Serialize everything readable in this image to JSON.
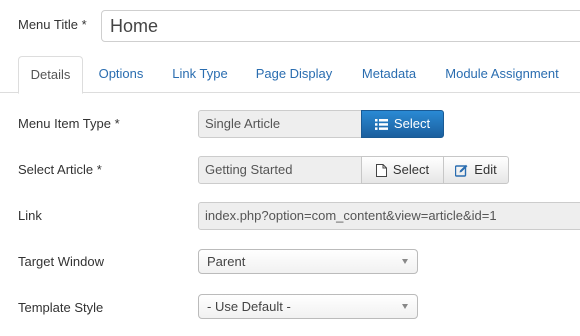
{
  "menu_title": {
    "label": "Menu Title *",
    "value": "Home"
  },
  "tabs": [
    {
      "label": "Details",
      "active": true
    },
    {
      "label": "Options"
    },
    {
      "label": "Link Type"
    },
    {
      "label": "Page Display"
    },
    {
      "label": "Metadata"
    },
    {
      "label": "Module Assignment"
    }
  ],
  "form": {
    "menu_item_type": {
      "label": "Menu Item Type *",
      "value": "Single Article",
      "select_label": "Select",
      "select_icon": "list-icon"
    },
    "select_article": {
      "label": "Select Article *",
      "value": "Getting Started",
      "select_label": "Select",
      "select_icon": "file-icon",
      "edit_label": "Edit",
      "edit_icon": "edit-icon"
    },
    "link": {
      "label": "Link",
      "value": "index.php?option=com_content&view=article&id=1"
    },
    "target_window": {
      "label": "Target Window",
      "value": "Parent"
    },
    "template_style": {
      "label": "Template Style",
      "value": "- Use Default -"
    }
  },
  "colors": {
    "link": "#2a6db0",
    "primary_top": "#2a8ad4",
    "primary_bottom": "#1b5f9e"
  }
}
